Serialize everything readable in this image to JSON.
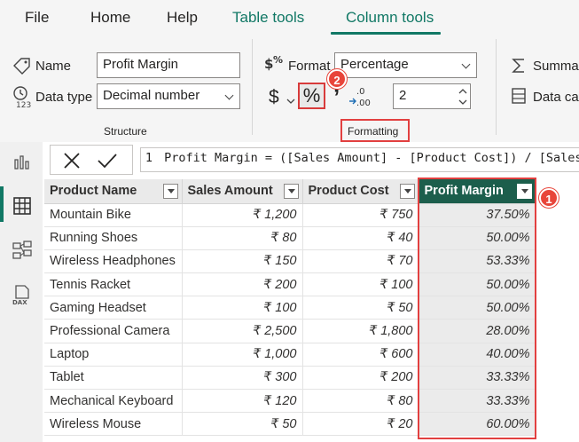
{
  "menu": {
    "tabs": [
      "File",
      "Home",
      "Help",
      "Table tools",
      "Column tools"
    ],
    "active_tab": "Column tools"
  },
  "ribbon": {
    "structure": {
      "name_label": "Name",
      "name_value": "Profit Margin",
      "datatype_label": "Data type",
      "datatype_value": "Decimal number",
      "group_label": "Structure"
    },
    "formatting": {
      "format_label": "Format",
      "format_value": "Percentage",
      "currency_symbol": "$",
      "percent_symbol": "%",
      "comma_symbol": "ʼ",
      "decimal_places": "2",
      "group_label": "Formatting"
    },
    "properties": {
      "summarization_label": "Summar",
      "category_label": "Data cat"
    }
  },
  "annotations": {
    "badge_1": "1",
    "badge_2": "2",
    "color": "#e8453a"
  },
  "formula_bar": {
    "line_number": "1",
    "expression": "Profit Margin = ([Sales Amount] - [Product Cost]) / [Sales Amount]"
  },
  "table": {
    "columns": [
      "Product Name",
      "Sales Amount",
      "Product Cost",
      "Profit Margin"
    ],
    "selected_column": "Profit Margin",
    "rows": [
      [
        "Mountain Bike",
        "₹ 1,200",
        "₹ 750",
        "37.50%"
      ],
      [
        "Running Shoes",
        "₹ 80",
        "₹ 40",
        "50.00%"
      ],
      [
        "Wireless Headphones",
        "₹ 150",
        "₹ 70",
        "53.33%"
      ],
      [
        "Tennis Racket",
        "₹ 200",
        "₹ 100",
        "50.00%"
      ],
      [
        "Gaming Headset",
        "₹ 100",
        "₹ 50",
        "50.00%"
      ],
      [
        "Professional Camera",
        "₹ 2,500",
        "₹ 1,800",
        "28.00%"
      ],
      [
        "Laptop",
        "₹ 1,000",
        "₹ 600",
        "40.00%"
      ],
      [
        "Tablet",
        "₹ 300",
        "₹ 200",
        "33.33%"
      ],
      [
        "Mechanical Keyboard",
        "₹ 120",
        "₹ 80",
        "33.33%"
      ],
      [
        "Wireless Mouse",
        "₹ 50",
        "₹ 20",
        "60.00%"
      ]
    ]
  },
  "colors": {
    "accent": "#117865",
    "selected_header": "#1c5e4c",
    "highlight": "#e24040"
  }
}
